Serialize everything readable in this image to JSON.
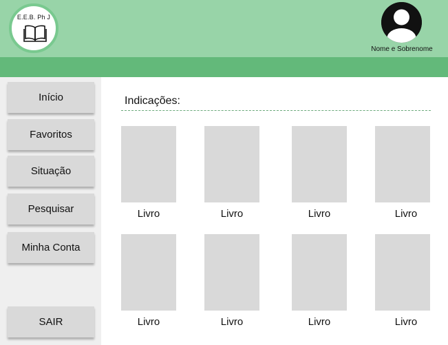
{
  "header": {
    "logo_text": "E.E.B. Ph J",
    "user_name": "Nome e Sobrenome"
  },
  "sidebar": {
    "items": [
      {
        "label": "Início"
      },
      {
        "label": "Favoritos"
      },
      {
        "label": "Situação"
      },
      {
        "label": "Pesquisar"
      },
      {
        "label": "Minha Conta"
      }
    ],
    "logout_label": "SAIR"
  },
  "main": {
    "section_title": "Indicações:",
    "books": [
      {
        "label": "Livro"
      },
      {
        "label": "Livro"
      },
      {
        "label": "Livro"
      },
      {
        "label": "Livro"
      },
      {
        "label": "Livro"
      },
      {
        "label": "Livro"
      },
      {
        "label": "Livro"
      },
      {
        "label": "Livro"
      }
    ]
  },
  "colors": {
    "header_bg": "#98d4a8",
    "subbar_bg": "#63b97a",
    "sidebar_bg": "#efefef",
    "button_bg": "#d9d9d9"
  }
}
